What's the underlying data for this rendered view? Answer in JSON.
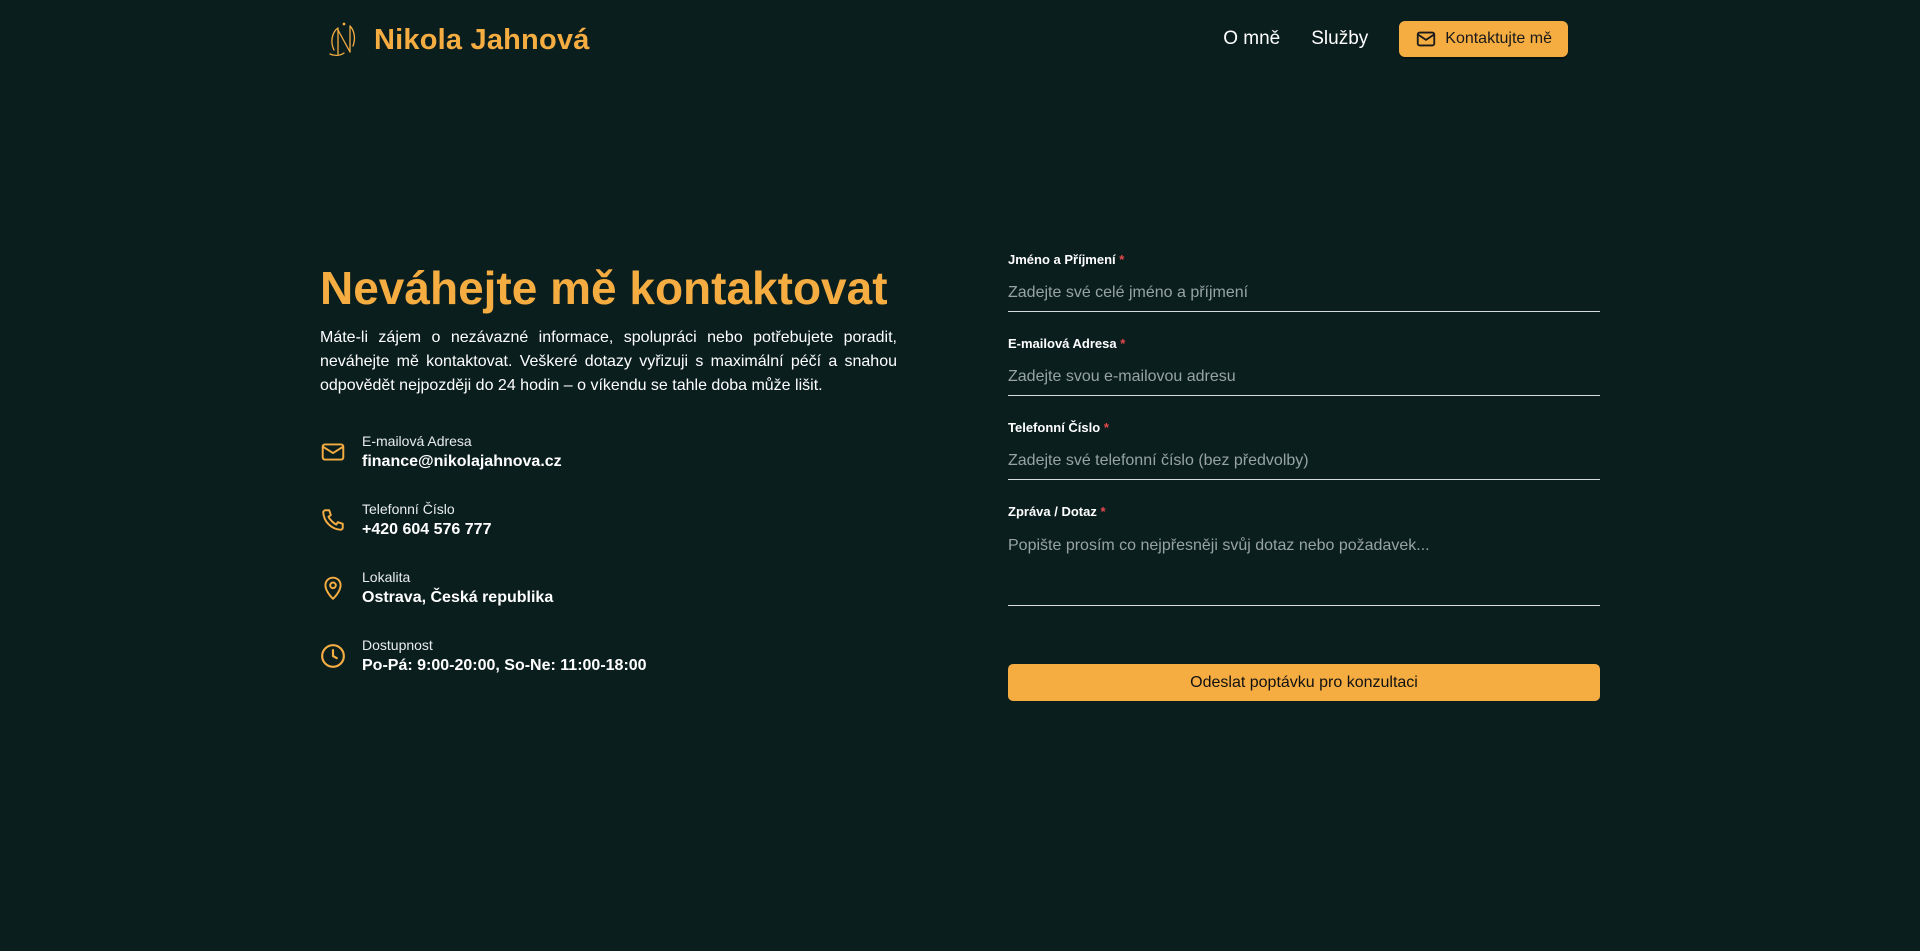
{
  "header": {
    "brand_name": "Nikola Jahnová",
    "logo_icon": "nj-monogram-logo",
    "nav": [
      {
        "label": "O mně"
      },
      {
        "label": "Služby"
      }
    ],
    "cta_label": "Kontaktujte mě",
    "cta_icon": "mail-icon"
  },
  "contact": {
    "headline": "Neváhejte mě kontaktovat",
    "intro": "Máte-li zájem o nezávazné informace, spolupráci nebo potřebujete poradit, neváhejte mě kontaktovat. Veškeré dotazy vyřizuji s maximální péčí a snahou odpovědět nejpozději do 24 hodin – o víkendu se tahle doba může lišit.",
    "items": [
      {
        "icon": "mail-icon",
        "label": "E-mailová Adresa",
        "value": "finance@nikolajahnova.cz"
      },
      {
        "icon": "phone-icon",
        "label": "Telefonní Číslo",
        "value": "+420 604 576 777"
      },
      {
        "icon": "map-pin-icon",
        "label": "Lokalita",
        "value": "Ostrava, Česká republika"
      },
      {
        "icon": "clock-icon",
        "label": "Dostupnost",
        "value": "Po-Pá: 9:00-20:00, So-Ne: 11:00-18:00"
      }
    ]
  },
  "form": {
    "required_mark": "*",
    "fields": [
      {
        "label": "Jméno a Příjmení",
        "placeholder": "Zadejte své celé jméno a příjmení",
        "value": ""
      },
      {
        "label": "E-mailová Adresa",
        "placeholder": "Zadejte svou e-mailovou adresu",
        "value": ""
      },
      {
        "label": "Telefonní Číslo",
        "placeholder": "Zadejte své telefonní číslo (bez předvolby)",
        "value": ""
      },
      {
        "label": "Zpráva / Dotaz",
        "placeholder": "Popište prosím co nejpřesněji svůj dotaz nebo požadavek...",
        "value": ""
      }
    ],
    "submit_label": "Odeslat poptávku pro konzultaci"
  },
  "colors": {
    "background": "#0b1e1e",
    "accent": "#f5ad42",
    "required": "#e5484d"
  }
}
